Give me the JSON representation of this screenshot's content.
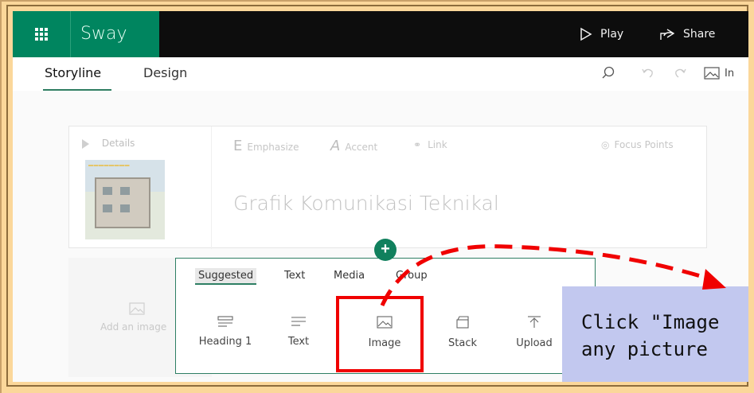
{
  "app": {
    "name": "Sway",
    "play_label": "Play",
    "share_label": "Share"
  },
  "tabs": {
    "storyline": "Storyline",
    "design": "Design",
    "insert_partial": "In"
  },
  "card": {
    "details": "Details",
    "emphasize": "Emphasize",
    "accent": "Accent",
    "link": "Link",
    "focus_points": "Focus Points",
    "title": "Grafik Komunikasi Teknikal"
  },
  "add_image": "Add an image",
  "panel": {
    "tabs": [
      "Suggested",
      "Text",
      "Media",
      "Group"
    ],
    "items": [
      "Heading 1",
      "Text",
      "Image",
      "Stack",
      "Upload"
    ]
  },
  "callout": {
    "line1": "Click \"Image",
    "line2": "any picture"
  },
  "colors": {
    "accent": "#00855f",
    "highlight": "#f00000",
    "callout_bg": "#c2c8ef",
    "frame_bg": "#fbd79a"
  },
  "icons": {
    "waffle": "waffle-icon",
    "play": "play-icon",
    "share": "share-icon",
    "search": "search-icon",
    "undo": "undo-icon",
    "redo": "redo-icon",
    "image": "image-icon",
    "plus": "plus-icon"
  }
}
